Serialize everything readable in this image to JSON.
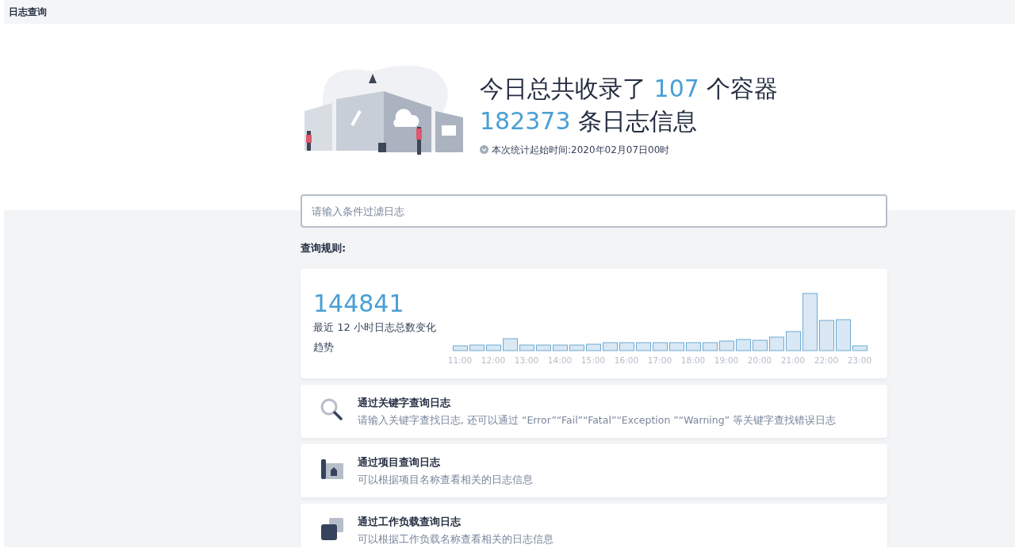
{
  "header": {
    "title": "日志查询"
  },
  "summary": {
    "line1": {
      "prefix": "今日总共收录了",
      "count": "107",
      "suffix": "个容器"
    },
    "line2": {
      "count": "182373",
      "suffix": "条日志信息"
    },
    "since": "本次统计起始时间:2020年02月07日00时"
  },
  "search": {
    "placeholder": "请输入条件过滤日志"
  },
  "rules_label": "查询规则:",
  "trend": {
    "total": "144841",
    "caption": "最近 12 小时日志总数变化趋势",
    "axis_labels": [
      "11:00",
      "12:00",
      "13:00",
      "14:00",
      "15:00",
      "16:00",
      "17:00",
      "18:00",
      "19:00",
      "20:00",
      "21:00",
      "22:00",
      "23:00"
    ]
  },
  "rules": [
    {
      "kind": "keyword",
      "title": "通过关键字查询日志",
      "description": "请输入关键字查找日志, 还可以通过 “Error”“Fail”“Fatal”“Exception ”“Warning” 等关键字查找错误日志"
    },
    {
      "kind": "project",
      "title": "通过项目查询日志",
      "description": "可以根据项目名称查看相关的日志信息"
    },
    {
      "kind": "workload",
      "title": "通过工作负载查询日志",
      "description": "可以根据工作负载名称查看相关的日志信息"
    }
  ]
}
